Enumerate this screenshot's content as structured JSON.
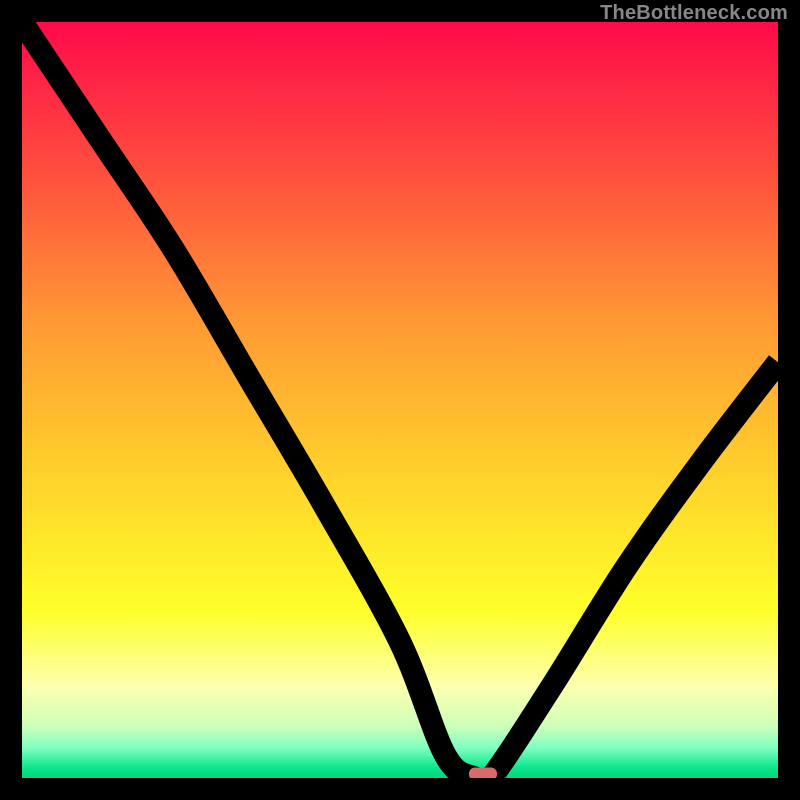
{
  "watermark": "TheBottleneck.com",
  "chart_data": {
    "type": "line",
    "title": "",
    "xlabel": "",
    "ylabel": "",
    "xlim": [
      0,
      100
    ],
    "ylim": [
      0,
      100
    ],
    "x": [
      0,
      10,
      20,
      30,
      40,
      50,
      56,
      60,
      62,
      70,
      80,
      90,
      100
    ],
    "y": [
      100,
      85,
      70,
      53,
      36,
      18,
      3,
      0,
      0,
      12,
      28,
      42,
      55
    ],
    "marker": {
      "x": 61,
      "y": 0,
      "color": "#d86a6a"
    },
    "gradient_stops": [
      {
        "pos": 0.0,
        "color": "#ff0a49"
      },
      {
        "pos": 0.2,
        "color": "#ff4f3e"
      },
      {
        "pos": 0.4,
        "color": "#ff9a34"
      },
      {
        "pos": 0.6,
        "color": "#ffd22b"
      },
      {
        "pos": 0.78,
        "color": "#ffff2a"
      },
      {
        "pos": 0.88,
        "color": "#fdffb0"
      },
      {
        "pos": 0.93,
        "color": "#cfffb8"
      },
      {
        "pos": 0.96,
        "color": "#7fffc0"
      },
      {
        "pos": 0.985,
        "color": "#10e890"
      },
      {
        "pos": 1.0,
        "color": "#00d67a"
      }
    ]
  }
}
